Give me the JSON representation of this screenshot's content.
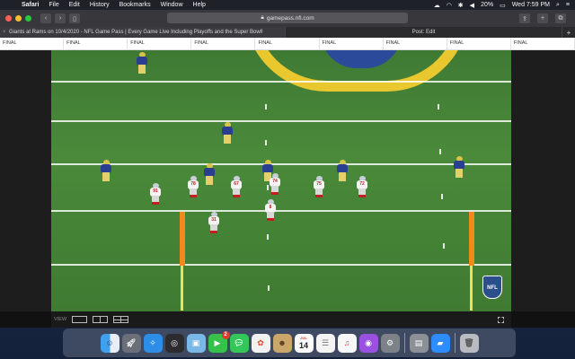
{
  "menubar": {
    "app_name": "Safari",
    "items": [
      "File",
      "Edit",
      "History",
      "Bookmarks",
      "Window",
      "Help"
    ],
    "battery": "20%",
    "clock": "Wed 7:59 PM"
  },
  "browser": {
    "url": "gamepass.nfl.com",
    "tabs": [
      {
        "label": "Giants at Rams on 10/4/2020 - NFL Game Pass | Every Game Live Including Playoffs and the Super Bowl!"
      },
      {
        "label": "Post: Edit"
      }
    ]
  },
  "scoreboard": {
    "cells": [
      "FINAL",
      "FINAL",
      "FINAL",
      "FINAL",
      "FINAL",
      "FINAL",
      "FINAL",
      "FINAL",
      "FINAL"
    ]
  },
  "video": {
    "view_label": "VIEW",
    "badge": "NFL",
    "giants_numbers": [
      "91",
      "78",
      "67",
      "74",
      "75",
      "8",
      "31",
      "72",
      "76"
    ]
  },
  "dock": {
    "messages_badge": "2",
    "calendar_month": "JUL",
    "calendar_day": "14"
  },
  "colors": {
    "field_green": "#4a8a3a",
    "rams_blue": "#2a3f8f",
    "rams_gold": "#e8c82e",
    "giants_red": "#c02020"
  }
}
